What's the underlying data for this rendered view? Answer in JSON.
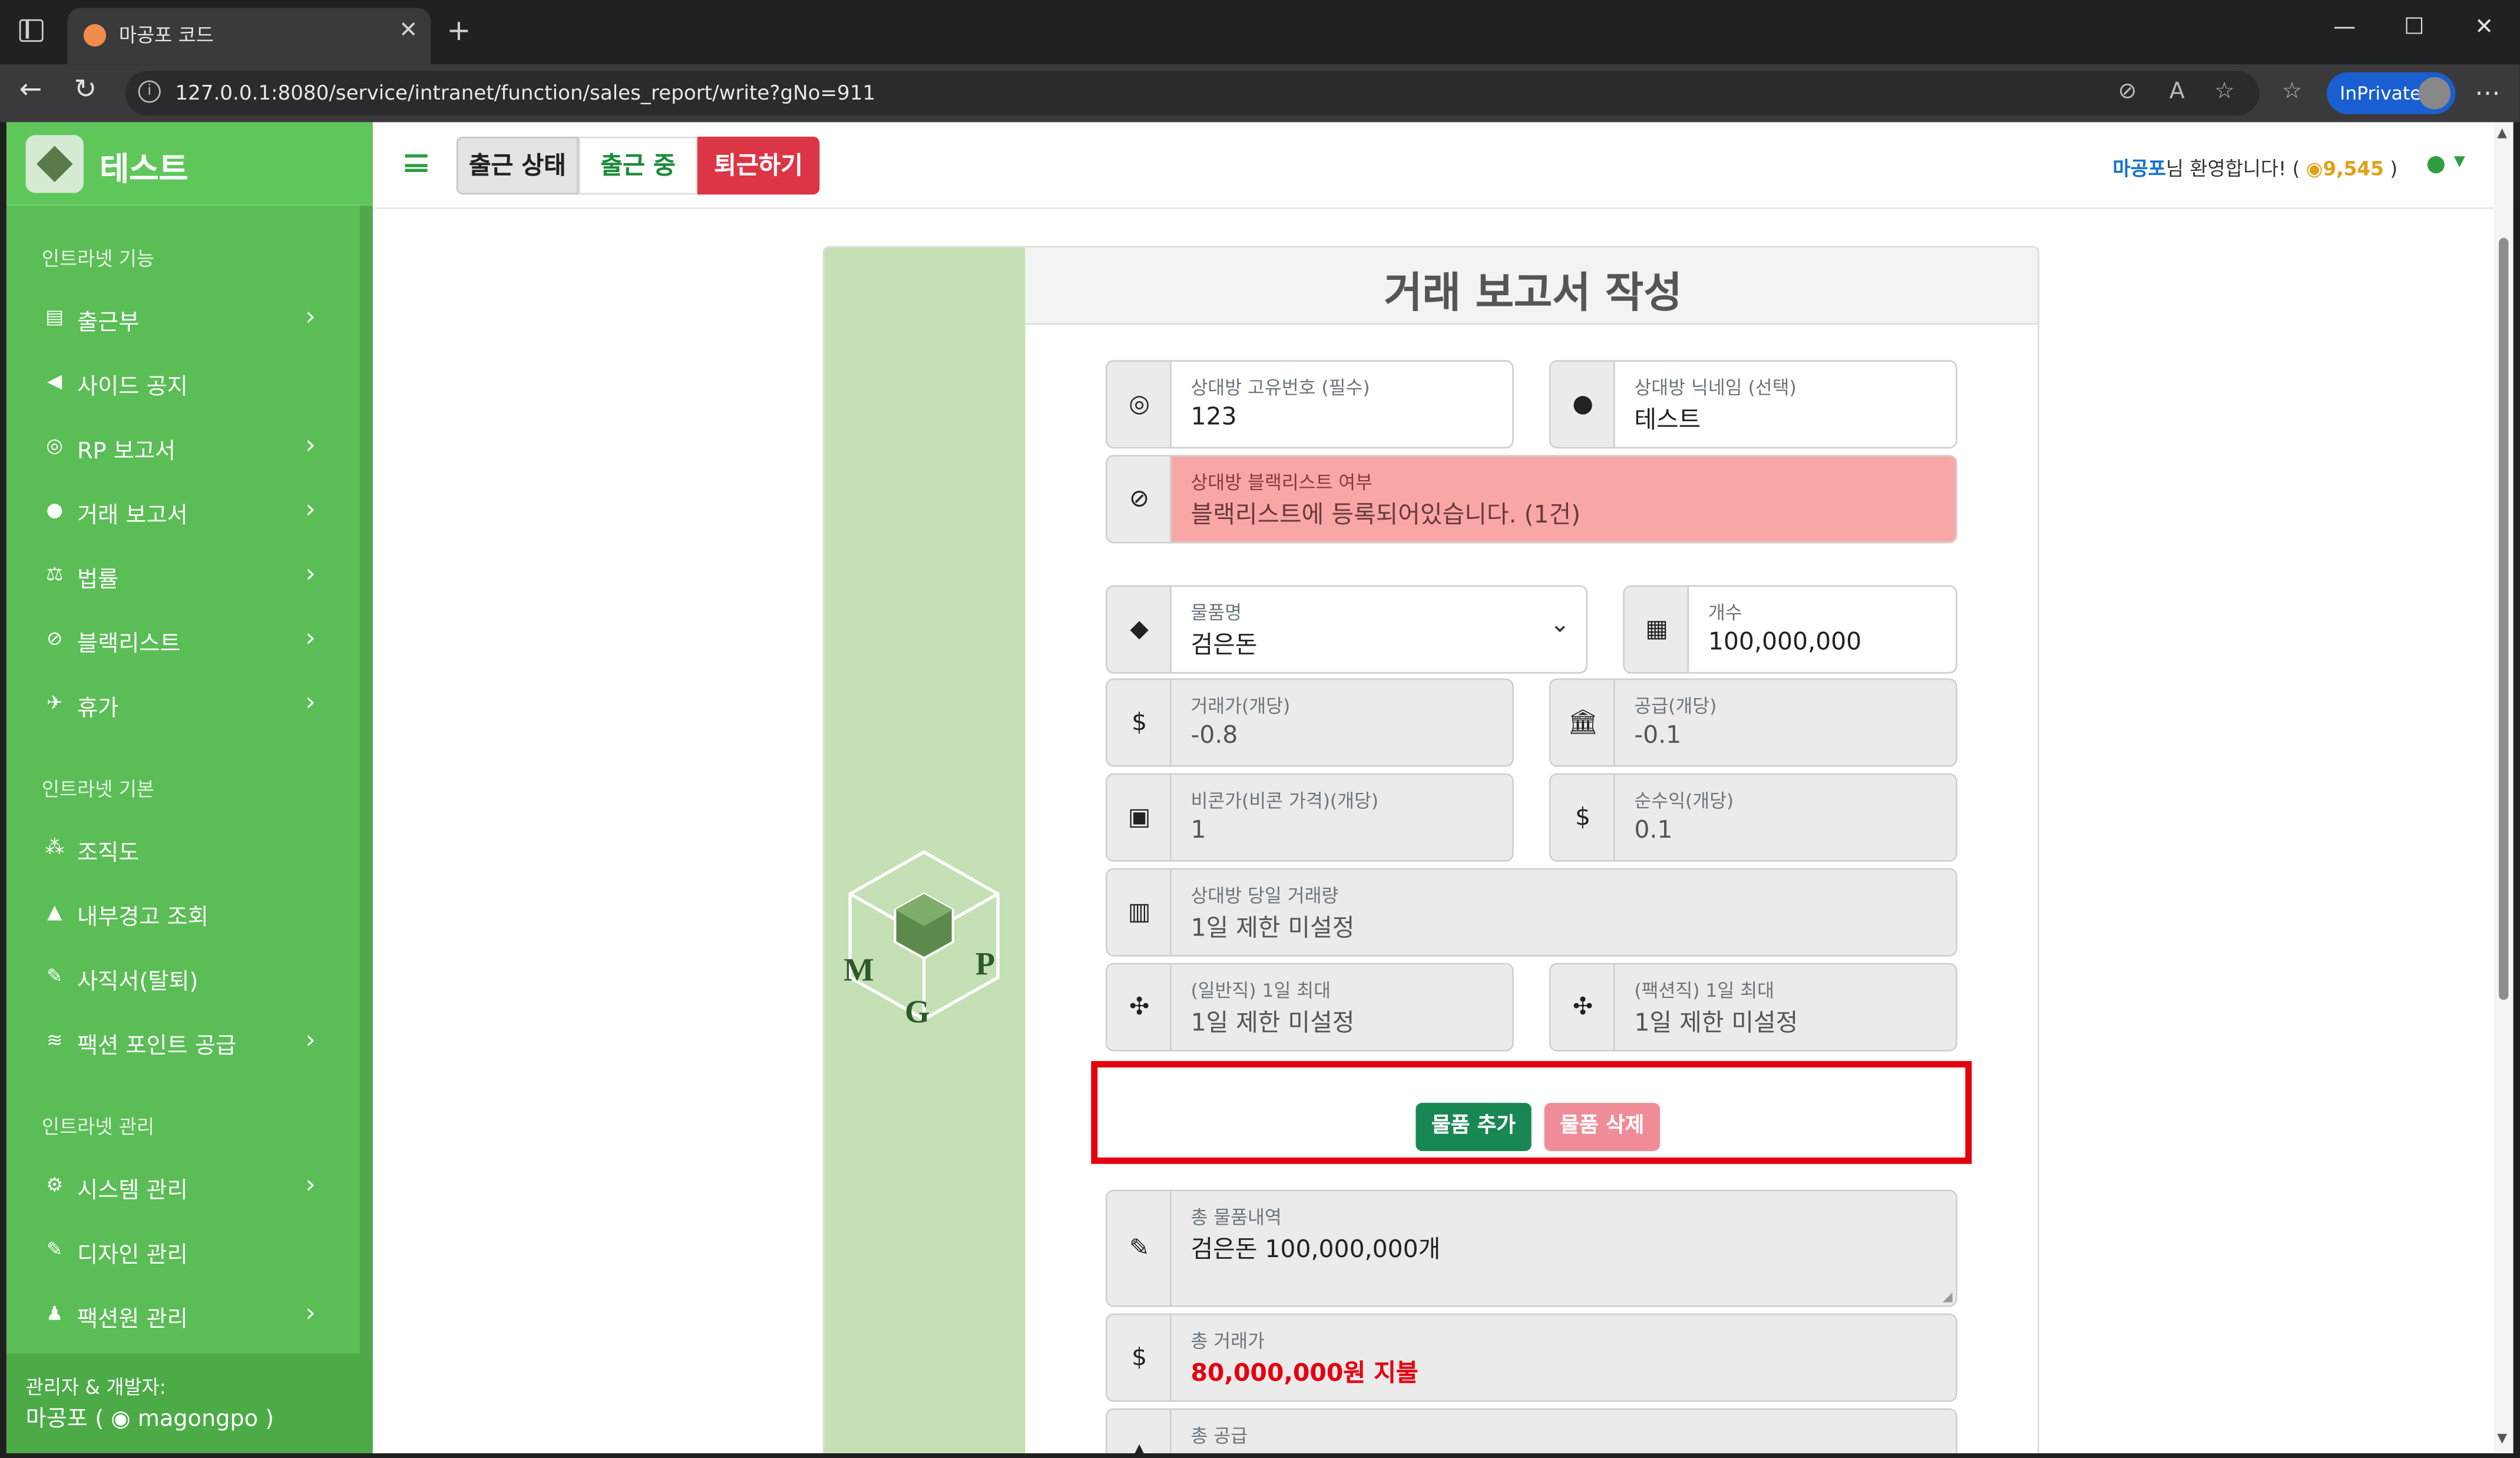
{
  "browser": {
    "tab_title": "마공포 코드",
    "url": "127.0.0.1:8080/service/intranet/function/sales_report/write?gNo=911",
    "inprivate": "InPrivate"
  },
  "sidebar": {
    "brand": "테스트",
    "sections": [
      {
        "heading": "인트라넷 기능"
      },
      {
        "heading": "인트라넷 기본"
      },
      {
        "heading": "인트라넷 관리"
      }
    ],
    "items": [
      {
        "label": "출근부"
      },
      {
        "label": "사이드 공지"
      },
      {
        "label": "RP 보고서"
      },
      {
        "label": "거래 보고서"
      },
      {
        "label": "법률"
      },
      {
        "label": "블랙리스트"
      },
      {
        "label": "휴가"
      },
      {
        "label": "조직도"
      },
      {
        "label": "내부경고 조회"
      },
      {
        "label": "사직서(탈퇴)"
      },
      {
        "label": "팩션 포인트 공급"
      },
      {
        "label": "시스템 관리"
      },
      {
        "label": "디자인 관리"
      },
      {
        "label": "팩션원 관리"
      }
    ],
    "footer_line1": "관리자 & 개발자:",
    "footer_name": "마공포 (",
    "footer_handle": "magongpo )"
  },
  "topbar": {
    "status_label": "출근 상태",
    "working_label": "출근 중",
    "leave_label": "퇴근하기",
    "welcome_name": "마공포",
    "welcome_text": "님 환영합니다! (",
    "coin": "9,545",
    "welcome_end": ")"
  },
  "form": {
    "title": "거래 보고서 작성",
    "logo_letters": {
      "m": "M",
      "g": "G",
      "p": "P"
    },
    "partner_id_label": "상대방 고유번호 (필수)",
    "partner_id_value": "123",
    "partner_nick_label": "상대방 닉네임 (선택)",
    "partner_nick_value": "테스트",
    "blacklist_label": "상대방 블랙리스트 여부",
    "blacklist_value": "블랙리스트에 등록되어있습니다. (1건)",
    "item_label": "물품명",
    "item_value": "검은돈",
    "qty_label": "개수",
    "qty_value": "100,000,000",
    "trade_price_label": "거래가(개당)",
    "trade_price_value": "-0.8",
    "supply_label": "공급(개당)",
    "supply_value": "-0.1",
    "bicorn_label": "비콘가(비콘 가격)(개당)",
    "bicorn_value": "1",
    "profit_label": "순수익(개당)",
    "profit_value": "0.1",
    "daily_label": "상대방 당일 거래량",
    "daily_value": "1일 제한 미설정",
    "normal_max_label": "(일반직) 1일 최대",
    "normal_max_value": "1일 제한 미설정",
    "faction_max_label": "(팩션직) 1일 최대",
    "faction_max_value": "1일 제한 미설정",
    "add_button": "물품 추가",
    "delete_button": "물품 삭제",
    "total_items_label": "총 물품내역",
    "total_items_value": "검은돈 100,000,000개",
    "total_trade_label": "총 거래가",
    "total_trade_value": "80,000,000원 지불",
    "total_supply_label": "총 공급"
  }
}
